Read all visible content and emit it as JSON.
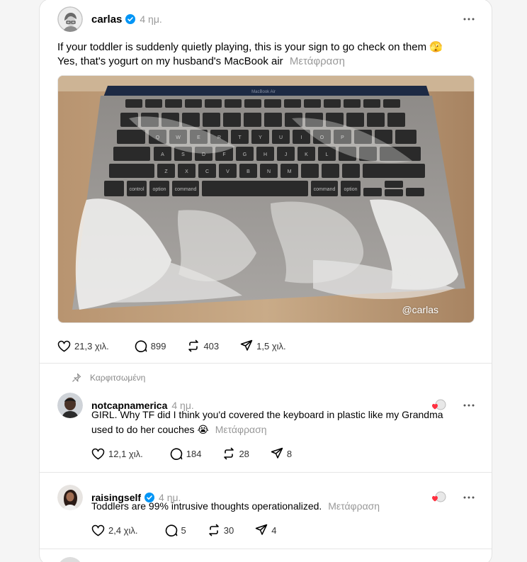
{
  "post": {
    "username": "carlas",
    "time": "4 ημ.",
    "line1": "If your toddler is suddenly quietly playing, this is your sign to go check on them",
    "line1_emoji": "🫣",
    "line2": "Yes, that's yogurt on my husband's MacBook air",
    "translate": "Μετάφραση",
    "image_brand": "MacBook Air",
    "image_credit": "@carlas",
    "likes": "21,3 χιλ.",
    "replies": "899",
    "reposts": "403",
    "shares": "1,5 χιλ."
  },
  "pinned_label": "Καρφιτσωμένη",
  "replies": [
    {
      "username": "notcapnamerica",
      "time": "4 ημ.",
      "line1": "GIRL. Why TF did I think you'd covered the keyboard in plastic like my Grandma",
      "line2": "used to do her couches",
      "emoji": "😭",
      "translate": "Μετάφραση",
      "likes": "12,1 χιλ.",
      "replies": "184",
      "reposts": "28",
      "shares": "8"
    },
    {
      "username": "raisingself",
      "time": "4 ημ.",
      "line1": "Toddlers are 99% intrusive thoughts operationalized.",
      "translate": "Μετάφραση",
      "likes": "2,4 χιλ.",
      "replies": "5",
      "reposts": "30",
      "shares": "4"
    }
  ],
  "keyboard": {
    "row1": [
      "Q",
      "W",
      "E",
      "R",
      "T",
      "Y",
      "U",
      "I",
      "O",
      "P"
    ],
    "row2": [
      "A",
      "S",
      "D",
      "F",
      "G",
      "H",
      "J",
      "K",
      "L"
    ],
    "row3": [
      "Z",
      "X",
      "C",
      "V",
      "B",
      "N",
      "M"
    ],
    "mods": [
      "control",
      "option",
      "command",
      "command",
      "option"
    ]
  },
  "colors": {
    "verified": "#0095f6",
    "heart_red": "#ff3040",
    "muted": "#999999"
  }
}
